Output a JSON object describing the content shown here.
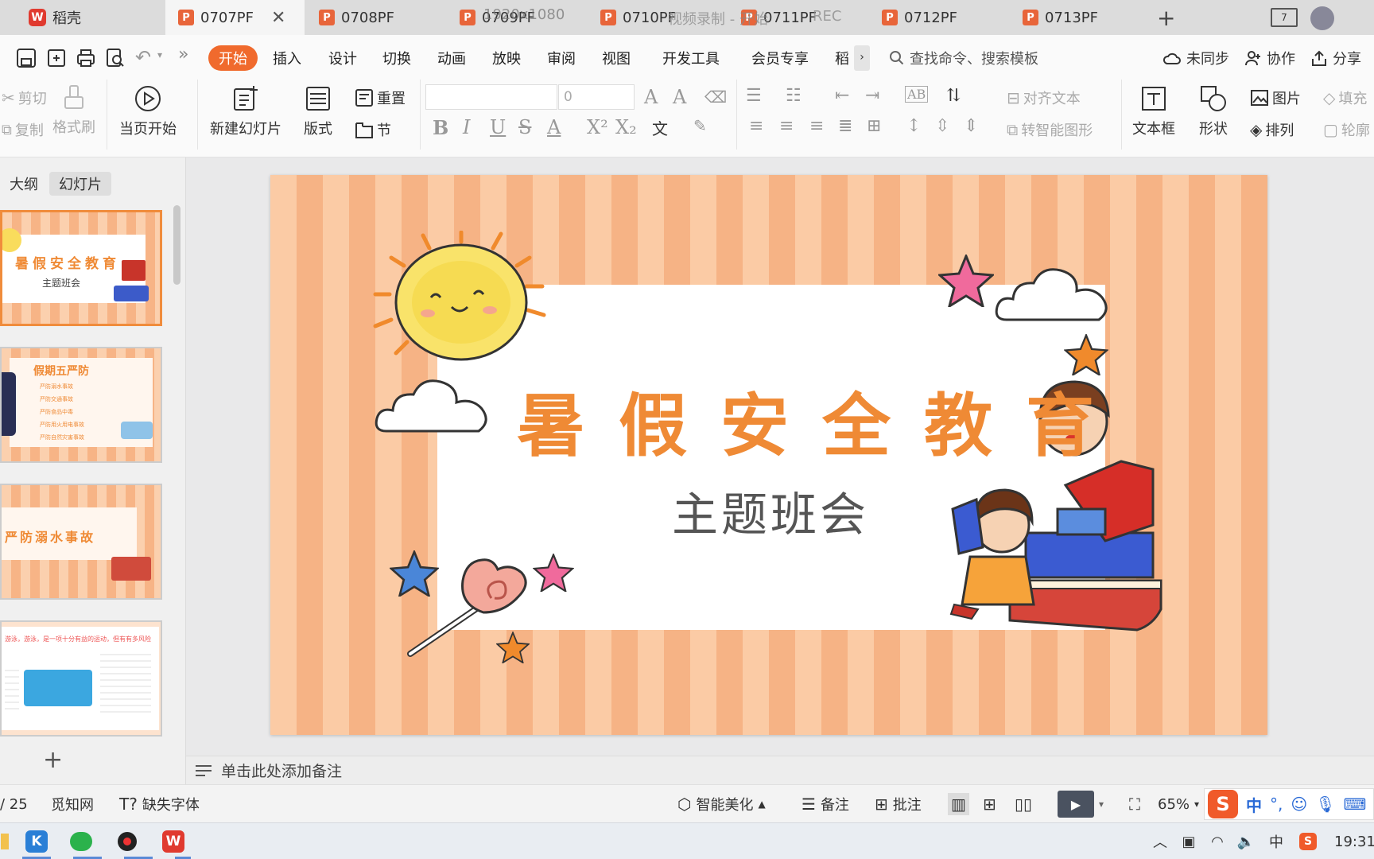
{
  "app": {
    "name": "稻壳"
  },
  "tabs": [
    {
      "label": "0707PF",
      "active": true
    },
    {
      "label": "0708PF"
    },
    {
      "label": "0709PF"
    },
    {
      "label": "0710PF"
    },
    {
      "label": "0711PF"
    },
    {
      "label": "0712PF"
    },
    {
      "label": "0713PF"
    }
  ],
  "overlay": {
    "resolution": "1920x1080",
    "recording": "视频录制 - 开始",
    "rec": "REC"
  },
  "menu": {
    "items": [
      "开始",
      "插入",
      "设计",
      "切换",
      "动画",
      "放映",
      "审阅",
      "视图",
      "开发工具",
      "会员专享",
      "稻"
    ],
    "active": "开始",
    "search_placeholder": "查找命令、搜索模板",
    "sync": "未同步",
    "collab": "协作",
    "share": "分享"
  },
  "ribbon": {
    "cut": "剪切",
    "copy": "复制",
    "format_painter": "格式刷",
    "from_current": "当页开始",
    "new_slide": "新建幻灯片",
    "layout": "版式",
    "reset": "重置",
    "section": "节",
    "font_size": "0",
    "align_text": "对齐文本",
    "smart_art": "转智能图形",
    "textbox": "文本框",
    "shape": "形状",
    "picture": "图片",
    "arrange": "排列",
    "fill": "填充",
    "outline": "轮廓"
  },
  "panel": {
    "tabs": [
      "大纲",
      "幻灯片"
    ],
    "active_tab": "幻灯片",
    "thumbnails": [
      {
        "title": "暑假安全教育",
        "subtitle": "主题班会"
      },
      {
        "title": "假期五严防",
        "items": [
          "严防溺水事故",
          "严防交通事故",
          "严防食品中毒",
          "严防用火用电事故",
          "严防自然灾害事故"
        ]
      },
      {
        "title": "严防溺水事故"
      },
      {
        "title": "游泳，游泳，是一项十分有益的运动，但有有多风险，应谨慎防"
      }
    ]
  },
  "slide": {
    "title": "暑假安全教育",
    "subtitle": "主题班会"
  },
  "notes": {
    "placeholder": "单击此处添加备注"
  },
  "status": {
    "page": "/ 25",
    "site": "觅知网",
    "missing_font": "缺失字体",
    "beautify": "智能美化",
    "notes": "备注",
    "comment": "批注",
    "zoom": "65%"
  },
  "ime": {
    "mode": "中"
  },
  "tray": {
    "ime": "中",
    "time": "19:31"
  },
  "colors": {
    "accent": "#f06a2d",
    "slide_title": "#ef8a35",
    "stripe_light": "#fbcba5",
    "stripe_dark": "#f6b385"
  }
}
